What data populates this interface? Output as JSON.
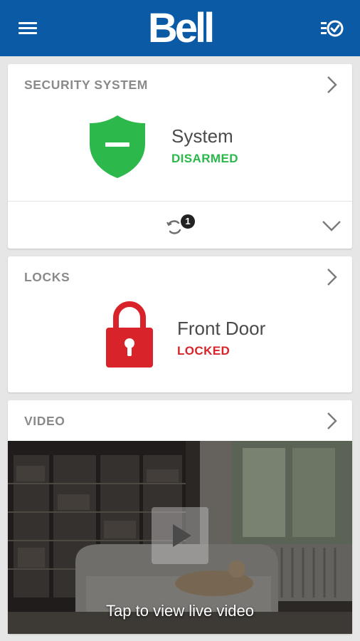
{
  "header": {
    "brand": "Bell",
    "menu_icon": "hamburger-menu-icon",
    "tasks_icon": "checklist-icon",
    "bar_color": "#0b5aa6"
  },
  "security": {
    "title": "SECURITY SYSTEM",
    "system_label": "System",
    "status": "DISARMED",
    "status_color": "#2bb84b",
    "shield_color": "#2db84c",
    "notification_count": "1"
  },
  "locks": {
    "title": "LOCKS",
    "lock_name": "Front Door",
    "status": "LOCKED",
    "status_color": "#d9232a",
    "lock_color": "#d9232a"
  },
  "video": {
    "title": "VIDEO",
    "overlay_text": "Tap to view live video"
  }
}
